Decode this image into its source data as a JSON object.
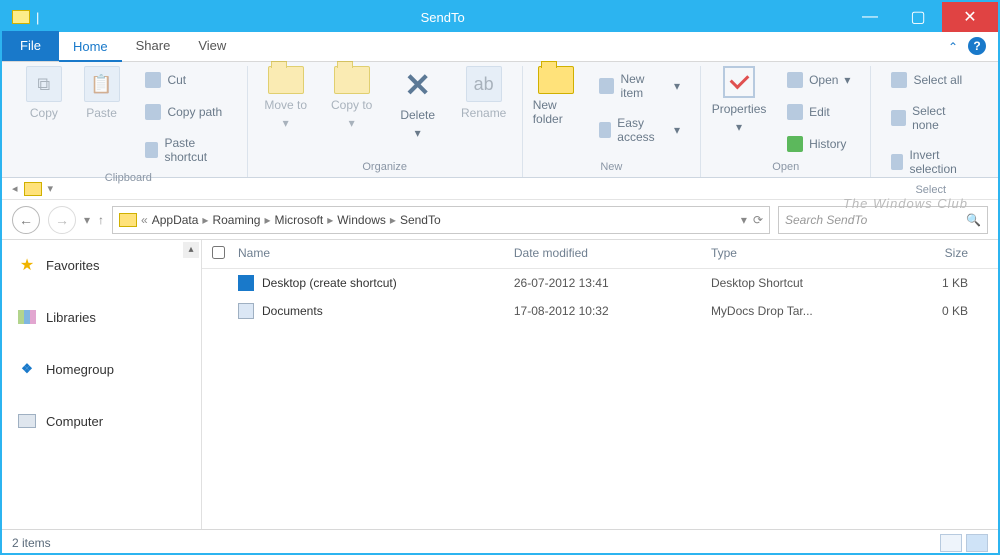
{
  "window": {
    "title": "SendTo"
  },
  "tabs": {
    "file": "File",
    "home": "Home",
    "share": "Share",
    "view": "View"
  },
  "ribbon": {
    "clipboard": {
      "label": "Clipboard",
      "copy": "Copy",
      "paste": "Paste",
      "cut": "Cut",
      "copy_path": "Copy path",
      "paste_shortcut": "Paste shortcut"
    },
    "organize": {
      "label": "Organize",
      "move_to": "Move to",
      "copy_to": "Copy to",
      "delete": "Delete",
      "rename": "Rename"
    },
    "new": {
      "label": "New",
      "new_folder": "New folder",
      "new_item": "New item",
      "easy_access": "Easy access"
    },
    "open": {
      "label": "Open",
      "properties": "Properties",
      "open": "Open",
      "edit": "Edit",
      "history": "History"
    },
    "select": {
      "label": "Select",
      "select_all": "Select all",
      "select_none": "Select none",
      "invert": "Invert selection"
    }
  },
  "breadcrumb": {
    "parts": [
      "AppData",
      "Roaming",
      "Microsoft",
      "Windows",
      "SendTo"
    ]
  },
  "search": {
    "placeholder": "Search SendTo"
  },
  "sidebar": {
    "favorites": "Favorites",
    "libraries": "Libraries",
    "homegroup": "Homegroup",
    "computer": "Computer"
  },
  "columns": {
    "name": "Name",
    "date": "Date modified",
    "type": "Type",
    "size": "Size"
  },
  "files": [
    {
      "name": "Desktop (create shortcut)",
      "date": "26-07-2012 13:41",
      "type": "Desktop Shortcut",
      "size": "1 KB"
    },
    {
      "name": "Documents",
      "date": "17-08-2012 10:32",
      "type": "MyDocs Drop Tar...",
      "size": "0 KB"
    }
  ],
  "status": {
    "text": "2 items"
  },
  "watermark": "The Windows Club"
}
